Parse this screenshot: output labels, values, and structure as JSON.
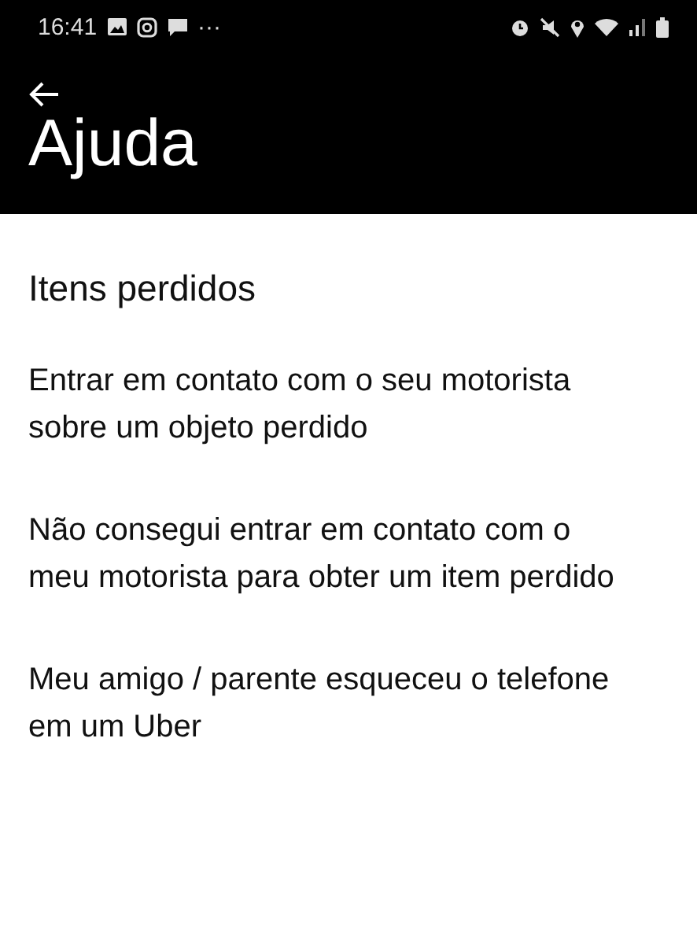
{
  "status_bar": {
    "time": "16:41",
    "more": "···"
  },
  "header": {
    "title": "Ajuda"
  },
  "section": {
    "title": "Itens perdidos"
  },
  "items": [
    {
      "label": "Entrar em contato com o seu motorista sobre um objeto perdido"
    },
    {
      "label": "Não consegui entrar em contato com o meu motorista para obter um item perdido"
    },
    {
      "label": "Meu amigo / parente esqueceu o telefone em um Uber"
    }
  ]
}
